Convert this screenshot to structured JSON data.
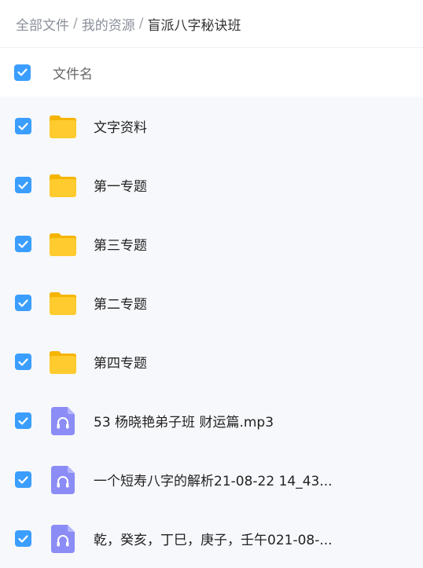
{
  "breadcrumb": {
    "items": [
      "全部文件",
      "我的资源",
      "盲派八字秘诀班"
    ],
    "separator": "/"
  },
  "header": {
    "column_label": "文件名",
    "checked": true
  },
  "colors": {
    "accent": "#3b9eff",
    "folder": "#ffcb2e",
    "audio": "#8b8cf6"
  },
  "files": [
    {
      "type": "folder",
      "icon": "folder-icon",
      "name": "文字资料"
    },
    {
      "type": "folder",
      "icon": "folder-icon",
      "name": "第一专题"
    },
    {
      "type": "folder",
      "icon": "folder-icon",
      "name": "第三专题"
    },
    {
      "type": "folder",
      "icon": "folder-icon",
      "name": "第二专题"
    },
    {
      "type": "folder",
      "icon": "folder-icon",
      "name": "第四专题"
    },
    {
      "type": "audio",
      "icon": "audio-file-icon",
      "name": "53 杨晓艳弟子班 财运篇.mp3"
    },
    {
      "type": "audio",
      "icon": "audio-file-icon",
      "name": "一个短寿八字的解析21-08-22 14_43..."
    },
    {
      "type": "audio",
      "icon": "audio-file-icon",
      "name": "乾，癸亥，丁巳，庚子，壬午021-08-..."
    }
  ]
}
